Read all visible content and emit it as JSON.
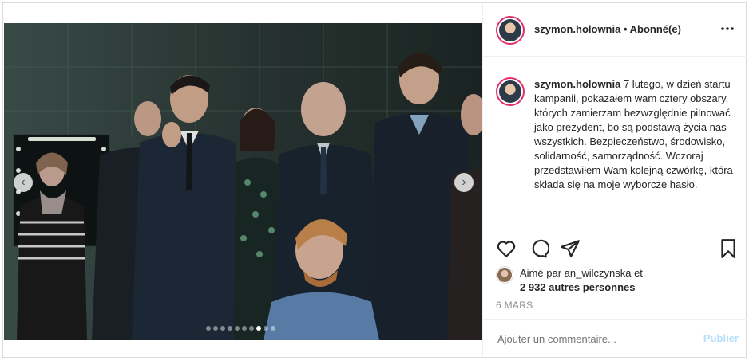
{
  "header": {
    "username": "szymon.holownia",
    "follow_state": "• Abonné(e)",
    "more_icon": "more-horizontal-icon"
  },
  "caption": {
    "username": "szymon.holownia",
    "text": "7 lutego, w dzień startu kampanii, pokazałem wam cztery obszary, których zamierzam bezwzględnie pilnować jako prezydent, bo są podstawą życia nas wszystkich. Bezpieczeństwo, środowisko, solidarność, samorządność. Wczoraj przedstawiłem Wam kolejną czwórkę, która składa się na moje wyborcze hasło."
  },
  "actions": {
    "like_icon": "heart-icon",
    "comment_icon": "comment-icon",
    "share_icon": "send-icon",
    "save_icon": "bookmark-icon"
  },
  "likes": {
    "prefix": "Aimé par ",
    "user": "an_wilczynska",
    "middle": " et",
    "count_text": "2 932 autres personnes"
  },
  "date": "6 MARS",
  "comment_box": {
    "placeholder": "Ajouter un commentaire...",
    "publish": "Publier"
  },
  "carousel": {
    "total": 10,
    "active_index": 7,
    "prev_icon": "chevron-left-icon",
    "next_icon": "chevron-right-icon"
  }
}
